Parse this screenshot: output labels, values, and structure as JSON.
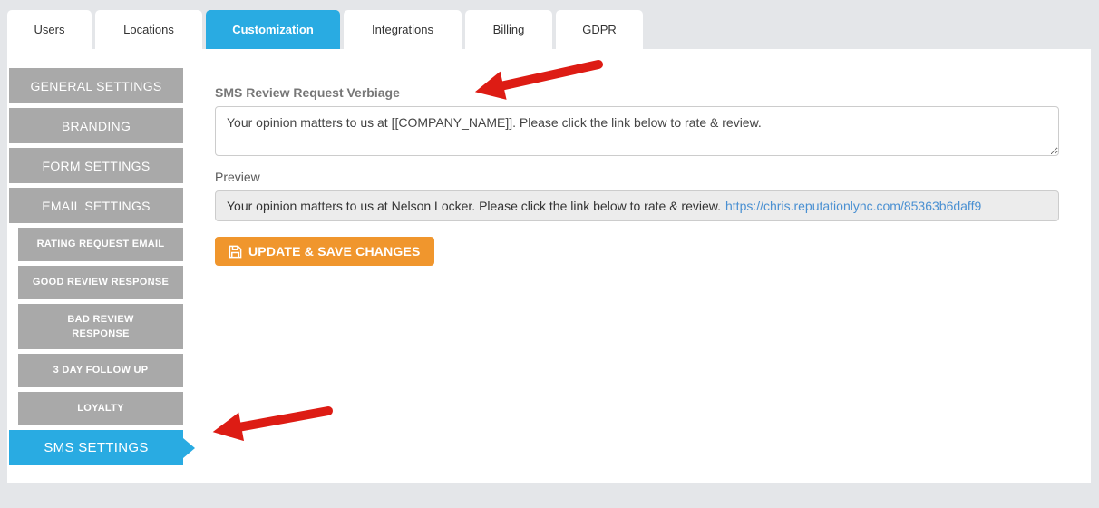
{
  "tabs": [
    {
      "label": "Users",
      "active": false
    },
    {
      "label": "Locations",
      "active": false
    },
    {
      "label": "Customization",
      "active": true
    },
    {
      "label": "Integrations",
      "active": false
    },
    {
      "label": "Billing",
      "active": false
    },
    {
      "label": "GDPR",
      "active": false
    }
  ],
  "sidebar": {
    "items": [
      {
        "label": "GENERAL SETTINGS",
        "level": 1,
        "active": false
      },
      {
        "label": "BRANDING",
        "level": 1,
        "active": false
      },
      {
        "label": "FORM SETTINGS",
        "level": 1,
        "active": false
      },
      {
        "label": "EMAIL SETTINGS",
        "level": 1,
        "active": false
      },
      {
        "label": "RATING REQUEST EMAIL",
        "level": 2,
        "active": false
      },
      {
        "label": "GOOD REVIEW RESPONSE",
        "level": 2,
        "active": false
      },
      {
        "label": "BAD REVIEW RESPONSE",
        "level": 2,
        "active": false
      },
      {
        "label": "3 DAY FOLLOW UP",
        "level": 2,
        "active": false
      },
      {
        "label": "LOYALTY",
        "level": 2,
        "active": false
      },
      {
        "label": "SMS SETTINGS",
        "level": 1,
        "active": true
      }
    ]
  },
  "main": {
    "verbiage_label": "SMS Review Request Verbiage",
    "verbiage_value": "Your opinion matters to us at [[COMPANY_NAME]]. Please click the link below to rate & review.",
    "preview_label": "Preview",
    "preview_text": "Your opinion matters to us at Nelson Locker. Please click the link below to rate & review.",
    "preview_link": "https://chris.reputationlync.com/85363b6daff9",
    "save_button_label": "UPDATE & SAVE CHANGES",
    "save_icon": "floppy-disk-icon"
  },
  "annotations": {
    "arrow_count": 2,
    "arrow_1_target": "SMS Review Request Verbiage field",
    "arrow_2_target": "SMS SETTINGS sidebar item"
  },
  "colors": {
    "accent_blue": "#29abe2",
    "sidebar_gray": "#a9a9a9",
    "button_orange": "#f0962d",
    "arrow_red": "#dd1c14",
    "page_background": "#e4e6e9",
    "preview_background": "#ececec",
    "link_blue": "#4a90d2"
  }
}
